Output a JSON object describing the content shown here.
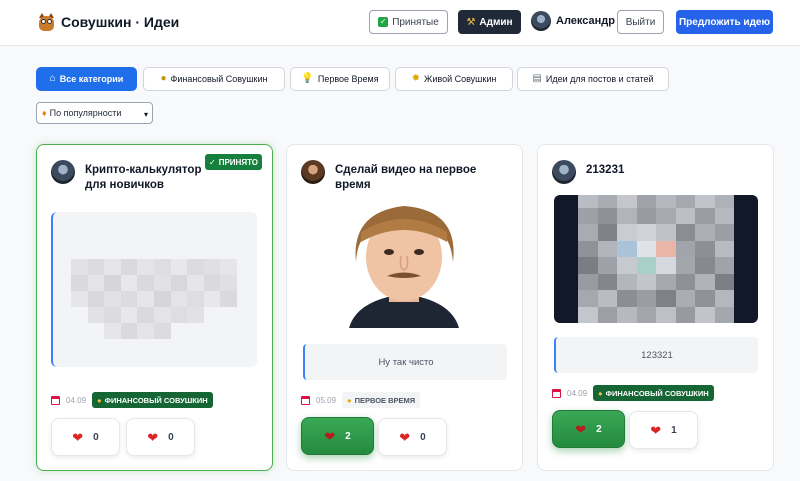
{
  "header": {
    "brand": "Совушкин · Идеи",
    "accepted_label": "Принятые",
    "admin_label": "Админ",
    "user_name": "Александр",
    "logout_label": "Выйти",
    "suggest_label": "Предложить идею"
  },
  "categories": [
    {
      "label": "Все категории",
      "icon": "home-icon"
    },
    {
      "label": "Финансовый Совушкин",
      "icon": "money-bag-icon"
    },
    {
      "label": "Первое Время",
      "icon": "lightbulb-icon"
    },
    {
      "label": "Живой Совушкин",
      "icon": "sparkle-icon"
    },
    {
      "label": "Идеи для постов и статей",
      "icon": "document-icon"
    }
  ],
  "sort": {
    "selected": "По популярности",
    "icon": "fire-icon"
  },
  "cards": [
    {
      "title": "Крипто-калькулятор для новичков",
      "badge": "ПРИНЯТО",
      "date": "04.09",
      "category": "ФИНАНСОВЫЙ СОВУШКИН",
      "likes": "0",
      "dislikes": "0",
      "liked": false
    },
    {
      "title": "Сделай видео на первое время",
      "quote": "Ну так чисто",
      "date": "05.09",
      "category": "ПЕРВОЕ ВРЕМЯ",
      "likes": "2",
      "dislikes": "0",
      "liked": true
    },
    {
      "title": "213231",
      "quote": "123321",
      "date": "04.09",
      "category": "ФИНАНСОВЫЙ СОВУШКИН",
      "likes": "2",
      "dislikes": "1",
      "liked": true
    }
  ],
  "colors": {
    "primary": "#2563eb",
    "accepted_green": "#15803d",
    "like_green": "#2e9b4a",
    "heart_red": "#dc2626"
  }
}
